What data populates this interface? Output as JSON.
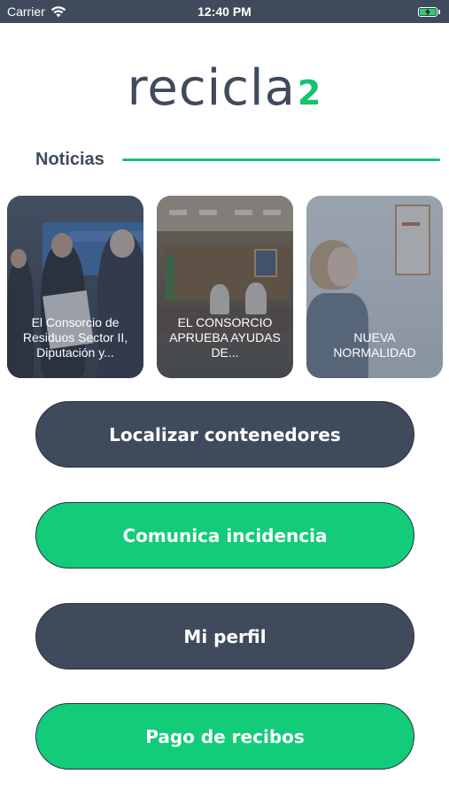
{
  "status_bar": {
    "carrier": "Carrier",
    "time": "12:40 PM"
  },
  "logo": {
    "text": "recicla",
    "number": "2"
  },
  "news_section": {
    "title": "Noticias",
    "items": [
      {
        "text": "El Consorcio de Residuos Sector II, Diputación y..."
      },
      {
        "text": "EL CONSORCIO APRUEBA AYUDAS DE..."
      },
      {
        "text": "NUEVA NORMALIDAD"
      }
    ]
  },
  "buttons": {
    "locate": "Localizar contenedores",
    "incident": "Comunica incidencia",
    "profile": "Mi perfil",
    "payments": "Pago de recibos"
  },
  "colors": {
    "primary_dark": "#3f4b5c",
    "accent_green": "#12cc79"
  }
}
